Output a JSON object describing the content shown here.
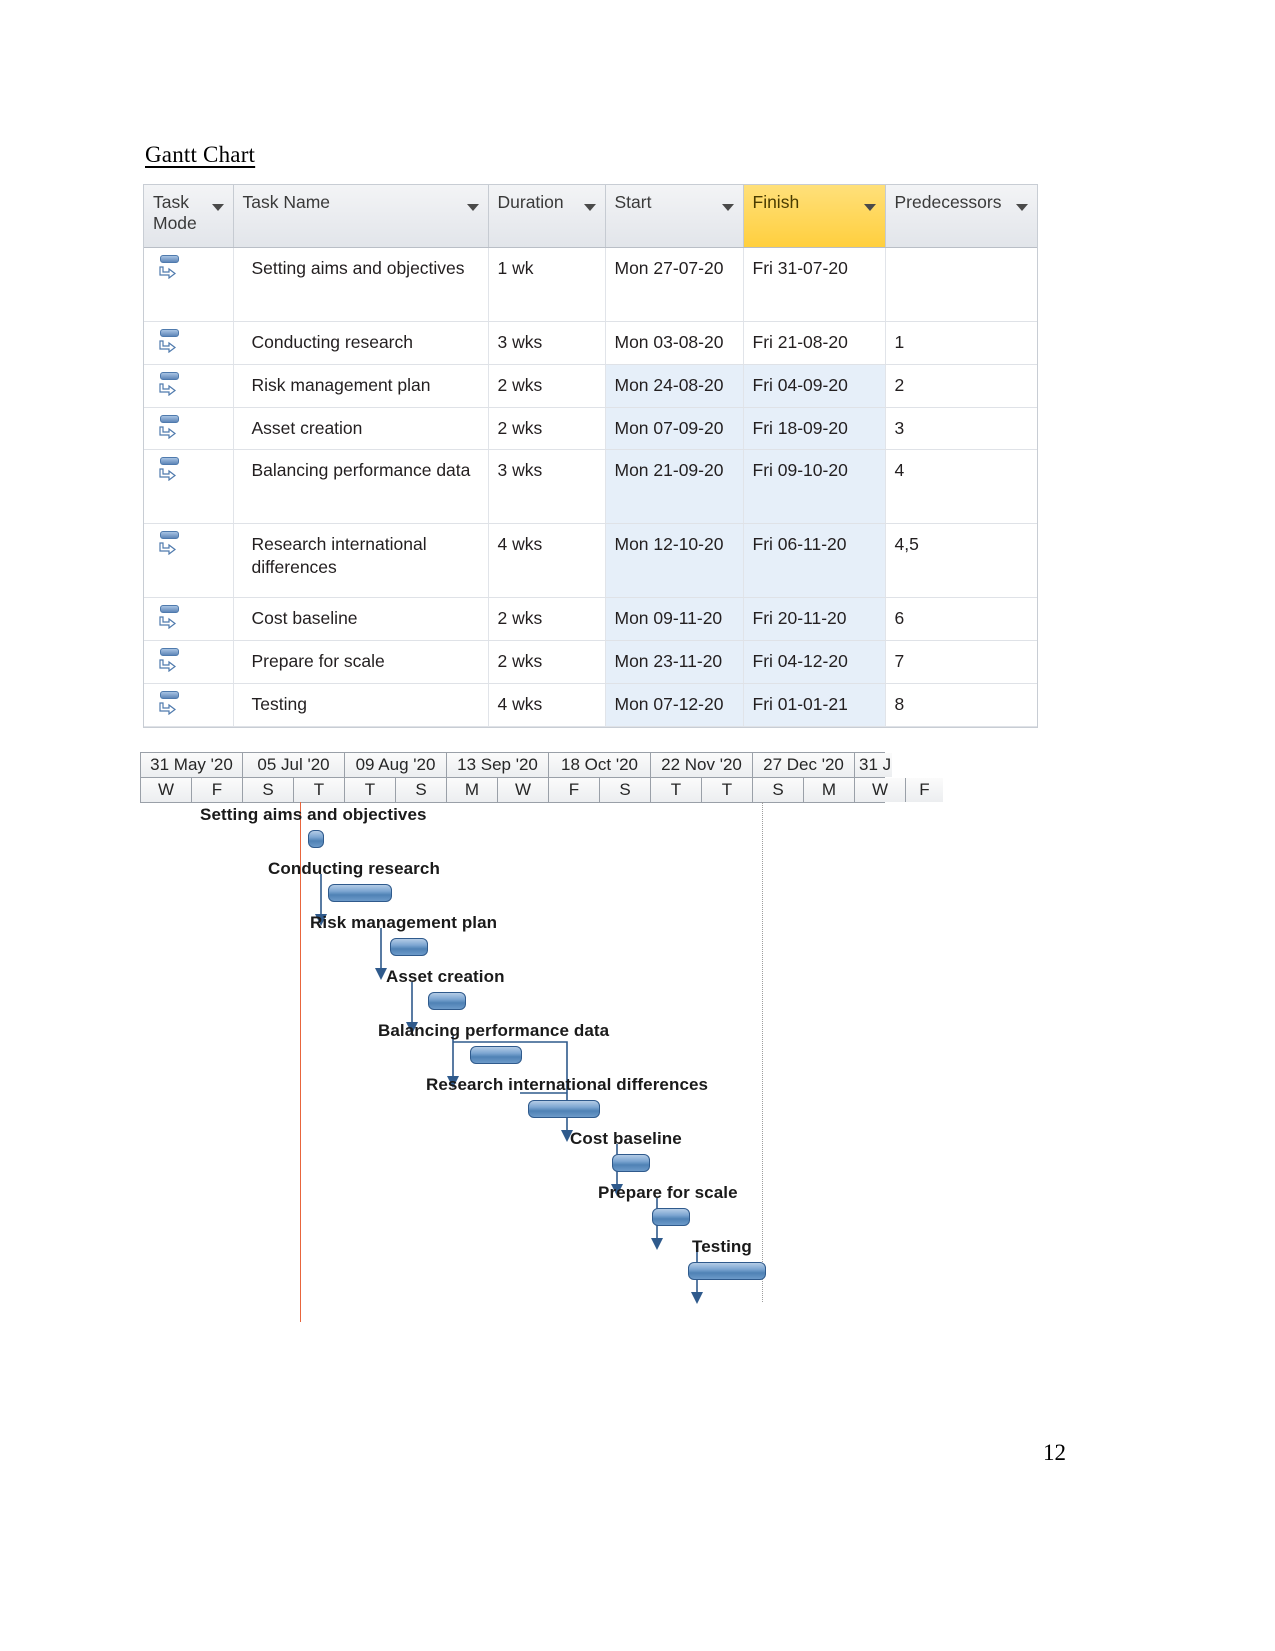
{
  "document": {
    "heading": "Gantt Chart",
    "page_number": "12"
  },
  "table": {
    "columns": [
      {
        "label": "Task Mode",
        "highlight": false
      },
      {
        "label": "Task Name",
        "highlight": false
      },
      {
        "label": "Duration",
        "highlight": false
      },
      {
        "label": "Start",
        "highlight": false
      },
      {
        "label": "Finish",
        "highlight": true
      },
      {
        "label": "Predecessors",
        "highlight": false
      }
    ],
    "rows": [
      {
        "mode": "auto-schedule-icon",
        "name": "Setting aims and objectives",
        "duration": "1 wk",
        "start": "Mon 27-07-20",
        "finish": "Fri 31-07-20",
        "predecessors": ""
      },
      {
        "mode": "auto-schedule-icon",
        "name": "Conducting research",
        "duration": "3 wks",
        "start": "Mon 03-08-20",
        "finish": "Fri 21-08-20",
        "predecessors": "1"
      },
      {
        "mode": "auto-schedule-icon",
        "name": "Risk management plan",
        "duration": "2 wks",
        "start": "Mon 24-08-20",
        "finish": "Fri 04-09-20",
        "predecessors": "2"
      },
      {
        "mode": "auto-schedule-icon",
        "name": "Asset creation",
        "duration": "2 wks",
        "start": "Mon 07-09-20",
        "finish": "Fri 18-09-20",
        "predecessors": "3"
      },
      {
        "mode": "auto-schedule-icon",
        "name": "Balancing performance data",
        "duration": "3 wks",
        "start": "Mon 21-09-20",
        "finish": "Fri 09-10-20",
        "predecessors": "4"
      },
      {
        "mode": "auto-schedule-icon",
        "name": "Research international differences",
        "duration": "4 wks",
        "start": "Mon 12-10-20",
        "finish": "Fri 06-11-20",
        "predecessors": "4,5"
      },
      {
        "mode": "auto-schedule-icon",
        "name": "Cost baseline",
        "duration": "2 wks",
        "start": "Mon 09-11-20",
        "finish": "Fri 20-11-20",
        "predecessors": "6"
      },
      {
        "mode": "auto-schedule-icon",
        "name": "Prepare for scale",
        "duration": "2 wks",
        "start": "Mon 23-11-20",
        "finish": "Fri 04-12-20",
        "predecessors": "7"
      },
      {
        "mode": "auto-schedule-icon",
        "name": "Testing",
        "duration": "4 wks",
        "start": "Mon 07-12-20",
        "finish": "Fri 01-01-21",
        "predecessors": "8"
      }
    ]
  },
  "chart_data": {
    "type": "gantt",
    "title": "Gantt Chart",
    "timeline_months": [
      "31 May '20",
      "05 Jul '20",
      "09 Aug '20",
      "13 Sep '20",
      "18 Oct '20",
      "22 Nov '20",
      "27 Dec '20",
      "31 J"
    ],
    "timeline_days": [
      "W",
      "F",
      "S",
      "T",
      "T",
      "S",
      "M",
      "W",
      "F",
      "S",
      "T",
      "T",
      "S",
      "M",
      "W",
      "F"
    ],
    "bar_color": "#4f82b5",
    "today_line_color": "#e8653c",
    "tasks": [
      {
        "name": "Setting aims and objectives",
        "start": "Mon 27-07-20",
        "finish": "Fri 31-07-20",
        "duration": "1 wk",
        "predecessors": ""
      },
      {
        "name": "Conducting research",
        "start": "Mon 03-08-20",
        "finish": "Fri 21-08-20",
        "duration": "3 wks",
        "predecessors": "1"
      },
      {
        "name": "Risk management plan",
        "start": "Mon 24-08-20",
        "finish": "Fri 04-09-20",
        "duration": "2 wks",
        "predecessors": "2"
      },
      {
        "name": "Asset creation",
        "start": "Mon 07-09-20",
        "finish": "Fri 18-09-20",
        "duration": "2 wks",
        "predecessors": "3"
      },
      {
        "name": "Balancing performance data",
        "start": "Mon 21-09-20",
        "finish": "Fri 09-10-20",
        "duration": "3 wks",
        "predecessors": "4"
      },
      {
        "name": "Research international differences",
        "start": "Mon 12-10-20",
        "finish": "Fri 06-11-20",
        "duration": "4 wks",
        "predecessors": "4,5"
      },
      {
        "name": "Cost baseline",
        "start": "Mon 09-11-20",
        "finish": "Fri 20-11-20",
        "duration": "2 wks",
        "predecessors": "6"
      },
      {
        "name": "Prepare for scale",
        "start": "Mon 23-11-20",
        "finish": "Fri 04-12-20",
        "duration": "2 wks",
        "predecessors": "7"
      },
      {
        "name": "Testing",
        "start": "Mon 07-12-20",
        "finish": "Fri 01-01-21",
        "duration": "4 wks",
        "predecessors": "8"
      }
    ]
  }
}
